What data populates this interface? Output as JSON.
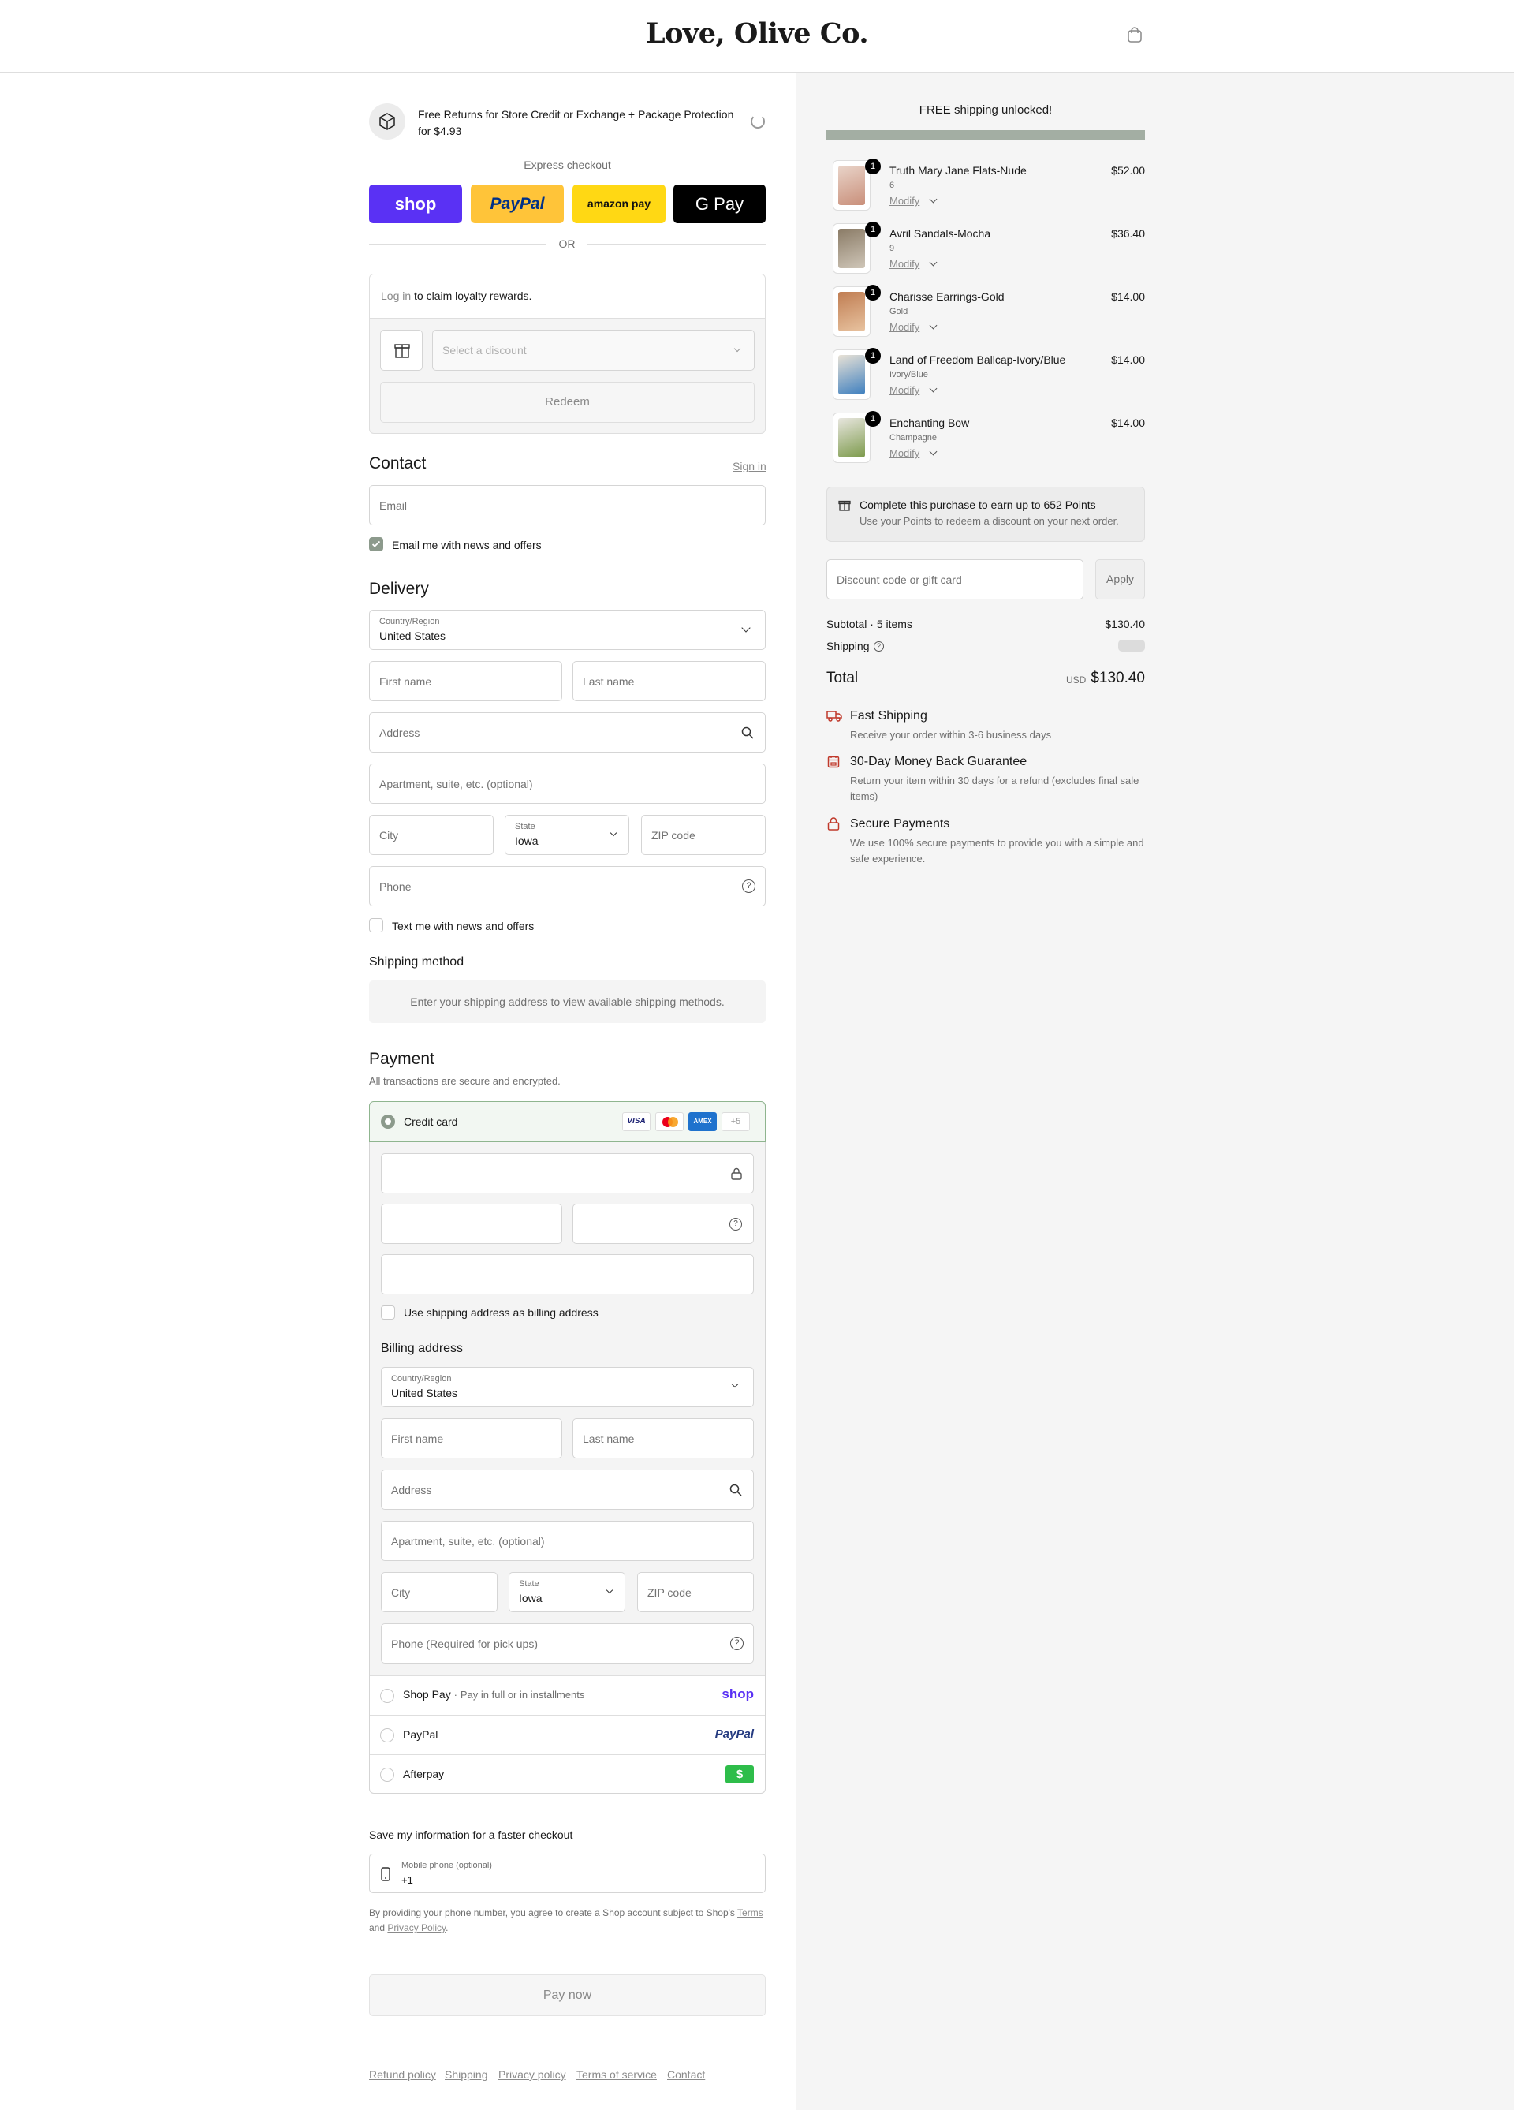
{
  "header": {
    "brand": "Love, Olive Co."
  },
  "left": {
    "protection": {
      "text": "Free Returns for Store Credit or Exchange + Package Protection for $4.93"
    },
    "express": {
      "label": "Express checkout",
      "shop": "shop",
      "paypal": "PayPal",
      "amazon": "amazon pay",
      "gpay": "G Pay",
      "or": "OR"
    },
    "loyalty": {
      "login": "Log in",
      "text": "to claim loyalty rewards.",
      "select_placeholder": "Select a discount",
      "redeem": "Redeem"
    },
    "contact": {
      "title": "Contact",
      "sign_in": "Sign in",
      "email_placeholder": "Email",
      "email_opt": "Email me with news and offers"
    },
    "delivery": {
      "title": "Delivery",
      "country_label": "Country/Region",
      "country": "United States",
      "first_name": "First name",
      "last_name": "Last name",
      "address": "Address",
      "apartment": "Apartment, suite, etc. (optional)",
      "city": "City",
      "state_label": "State",
      "state": "Iowa",
      "zip": "ZIP code",
      "phone": "Phone",
      "text_opt": "Text me with news and offers"
    },
    "shipping": {
      "title": "Shipping method",
      "note": "Enter your shipping address to view available shipping methods."
    },
    "payment": {
      "title": "Payment",
      "subtitle": "All transactions are secure and encrypted.",
      "credit_card": "Credit card",
      "more_cards": "+5",
      "use_shipping": "Use shipping address as billing address",
      "billing_title": "Billing address",
      "billing_phone": "Phone (Required for pick ups)",
      "shop_pay": "Shop Pay",
      "shop_pay_sub": "Pay in full or in installments",
      "shop_logo": "shop",
      "paypal": "PayPal",
      "paypal_logo": "PayPal",
      "afterpay": "Afterpay",
      "afterpay_logo": "$"
    },
    "save": {
      "title": "Save my information for a faster checkout",
      "mobile_label": "Mobile phone (optional)",
      "mobile_value": "+1",
      "legal_a": "By providing your phone number, you agree to create a Shop account subject to Shop's",
      "terms": "Terms",
      "and": "and",
      "privacy": "Privacy Policy",
      "dot": "."
    },
    "pay_now": "Pay now",
    "footer": [
      "Refund policy",
      "Shipping",
      "Privacy policy",
      "Terms of service",
      "Contact"
    ]
  },
  "summary": {
    "free_shipping": "FREE shipping unlocked!",
    "progress": 1.0,
    "items": [
      {
        "name": "Truth Mary Jane Flats-Nude",
        "variant": "6",
        "price": "$52.00",
        "qty": "1",
        "modify": "Modify"
      },
      {
        "name": "Avril Sandals-Mocha",
        "variant": "9",
        "price": "$36.40",
        "qty": "1",
        "modify": "Modify"
      },
      {
        "name": "Charisse Earrings-Gold",
        "variant": "Gold",
        "price": "$14.00",
        "qty": "1",
        "modify": "Modify"
      },
      {
        "name": "Land of Freedom Ballcap-Ivory/Blue",
        "variant": "Ivory/Blue",
        "price": "$14.00",
        "qty": "1",
        "modify": "Modify"
      },
      {
        "name": "Enchanting Bow",
        "variant": "Champagne",
        "price": "$14.00",
        "qty": "1",
        "modify": "Modify"
      }
    ],
    "points": {
      "title": "Complete this purchase to earn up to 652 Points",
      "sub": "Use your Points to redeem a discount on your next order."
    },
    "discount": {
      "placeholder": "Discount code or gift card",
      "apply": "Apply"
    },
    "subtotal_label": "Subtotal · 5 items",
    "subtotal": "$130.40",
    "shipping_label": "Shipping",
    "total_label": "Total",
    "currency": "USD",
    "total": "$130.40",
    "perks": [
      {
        "title": "Fast Shipping",
        "text": "Receive your order within 3-6 business days"
      },
      {
        "title": "30-Day Money Back Guarantee",
        "text": "Return your item within 30 days for a refund (excludes final sale items)"
      },
      {
        "title": "Secure Payments",
        "text": "We use 100% secure payments to provide you with a simple and safe experience."
      }
    ],
    "colors": {
      "accent": "#c0392b",
      "progress": "#a3aea3",
      "shop_purple": "#5a31f4"
    }
  }
}
